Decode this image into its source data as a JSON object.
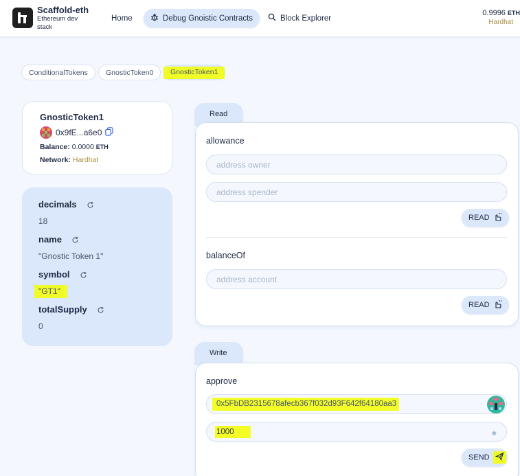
{
  "header": {
    "brand_title": "Scaffold-eth",
    "brand_subtitle": "Ethereum dev stack",
    "nav": {
      "home": "Home",
      "debug": "Debug Gnoistic Contracts",
      "explorer": "Block Explorer"
    },
    "balance": "0.9996",
    "currency": "ETH",
    "network": "Hardhat"
  },
  "contract_tabs": [
    "ConditionalTokens",
    "GnosticToken0",
    "GnosticToken1"
  ],
  "contract": {
    "name": "GnosticToken1",
    "address_short": "0x9fE...a6e0",
    "balance_label": "Balance:",
    "balance_value": "0.0000",
    "balance_currency": "ETH",
    "network_label": "Network:",
    "network_value": "Hardhat"
  },
  "variables": [
    {
      "name": "decimals",
      "value": "18"
    },
    {
      "name": "name",
      "value": "\"Gnostic Token 1\""
    },
    {
      "name": "symbol",
      "value": "\"GT1\""
    },
    {
      "name": "totalSupply",
      "value": "0"
    }
  ],
  "read": {
    "tab_label": "Read",
    "functions": [
      {
        "name": "allowance",
        "inputs": [
          "address owner",
          "address spender"
        ],
        "button": "READ"
      },
      {
        "name": "balanceOf",
        "inputs": [
          "address account"
        ],
        "button": "READ"
      }
    ]
  },
  "write": {
    "tab_label": "Write",
    "function_name": "approve",
    "spender_value": "0x5FbDB2315678afecb367f032d93F642f64180aa3",
    "amount_value": "1000",
    "button": "SEND"
  },
  "colors": {
    "accent_bg": "#dbe7fb",
    "page_bg": "#f4f8fe",
    "network_gold": "#a98b3c",
    "highlight": "#f2ff00"
  }
}
